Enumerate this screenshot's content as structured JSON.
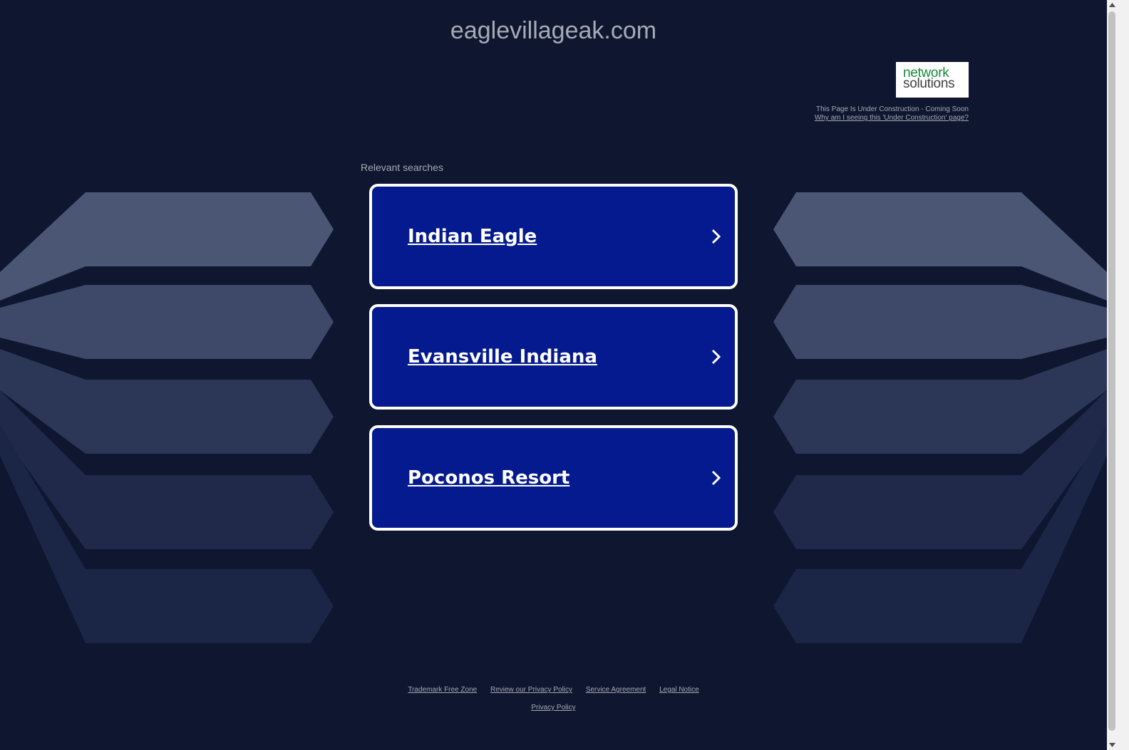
{
  "domain_title": "eaglevillageak.com",
  "logo": {
    "line1": "network",
    "line2": "solutions"
  },
  "notice": {
    "text": "This Page Is Under Construction - Coming Soon",
    "link": "Why am I seeing this 'Under Construction' page?"
  },
  "relevant_label": "Relevant searches",
  "searches": [
    {
      "label": "Indian Eagle"
    },
    {
      "label": "Evansville Indiana"
    },
    {
      "label": "Poconos Resort"
    }
  ],
  "footer": {
    "links": [
      "Trademark Free Zone",
      "Review our Privacy Policy",
      "Service Agreement",
      "Legal Notice"
    ],
    "privacy": "Privacy Policy"
  },
  "colors": {
    "background": "#0e1630",
    "card": "#041a8e",
    "card_border": "#ffffff",
    "logo_green": "#1a8a3a"
  },
  "icons": [
    "chevron-right-icon",
    "scroll-up-arrow-icon",
    "scroll-down-arrow-icon"
  ]
}
